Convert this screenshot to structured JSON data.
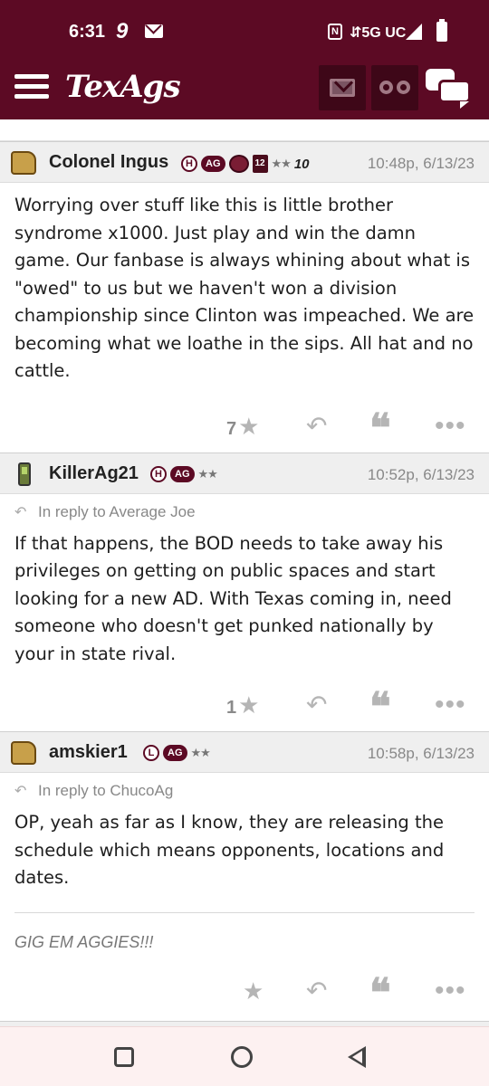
{
  "status_bar": {
    "time": "6:31",
    "notification_glyph": "9",
    "nfc_label": "N",
    "network": "⇵5G UC",
    "icons": [
      "mail-icon",
      "nfc-icon",
      "signal-icon",
      "battery-icon"
    ]
  },
  "header": {
    "logo": "TexAgs",
    "brand_color": "#5c0a24",
    "buttons": [
      "menu-icon",
      "mail-icon",
      "binoculars-icon",
      "chat-icon"
    ]
  },
  "posts": [
    {
      "username": "Colonel Ingus",
      "badges": {
        "membership": "H",
        "ag": "AG",
        "stars": "★★",
        "extra": "10"
      },
      "timestamp": "10:48p, 6/13/23",
      "reply_to": "",
      "body": "Worrying over stuff like this is little brother syndrome x1000. Just play and win the damn game. Our fanbase is always whining about what is \"owed\" to us but we haven't won a division championship since Clinton was impeached. We are becoming what we loathe in the sips. All hat and no cattle.",
      "star_count": "7",
      "avatar": "thumbs-up-icon"
    },
    {
      "username": "KillerAg21",
      "badges": {
        "membership": "H",
        "ag": "AG",
        "stars": "★★"
      },
      "timestamp": "10:52p, 6/13/23",
      "reply_to": "In reply to Average Joe",
      "body": "If that happens, the BOD needs to take away his privileges on getting on public spaces and start looking for a new AD. With Texas coming in, need someone who doesn't get punked nationally by your in state rival.",
      "star_count": "1",
      "avatar": "phone-icon"
    },
    {
      "username": "amskier1",
      "badges": {
        "membership": "L",
        "ag": "AG",
        "stars": "★★"
      },
      "timestamp": "10:58p, 6/13/23",
      "reply_to": "In reply to ChucoAg",
      "body": "OP, yeah as far as I know, they are releasing the schedule which means opponents, locations and dates.",
      "signature": "GIG EM AGGIES!!!",
      "star_count": "",
      "avatar": "thumbs-up-icon"
    }
  ],
  "actions": {
    "star_glyph": "★",
    "reply_glyph": "↶",
    "quote_glyph": "❝",
    "more_glyph": "•••"
  }
}
